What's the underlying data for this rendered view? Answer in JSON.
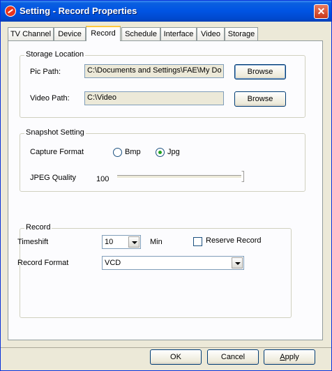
{
  "window": {
    "title": "Setting - Record Properties",
    "close_symbol": "✕"
  },
  "tabs": [
    {
      "label": "TV Channel"
    },
    {
      "label": "Device"
    },
    {
      "label": "Record"
    },
    {
      "label": "Schedule"
    },
    {
      "label": "Interface"
    },
    {
      "label": "Video"
    },
    {
      "label": "Storage"
    }
  ],
  "active_tab": "Record",
  "storage_location": {
    "legend": "Storage Location",
    "pic_path_label": "Pic Path:",
    "pic_path_value": "C:\\Documents and Settings\\FAE\\My Do",
    "video_path_label": "Video Path:",
    "video_path_value": "C:\\Video",
    "browse_label": "Browse"
  },
  "snapshot": {
    "legend": "Snapshot Setting",
    "capture_format_label": "Capture Format",
    "options": [
      {
        "label": "Bmp",
        "selected": false
      },
      {
        "label": "Jpg",
        "selected": true
      }
    ],
    "jpeg_quality_label": "JPEG Quality",
    "jpeg_quality_value": "100"
  },
  "record": {
    "legend": "Record",
    "timeshift_label": "Timeshift",
    "timeshift_value": "10",
    "timeshift_unit": "Min",
    "reserve_record_label": "Reserve Record",
    "reserve_record_checked": false,
    "record_format_label": "Record Format",
    "record_format_value": "VCD"
  },
  "footer": {
    "ok": "OK",
    "cancel": "Cancel",
    "apply_prefix": "A",
    "apply_rest": "pply"
  }
}
